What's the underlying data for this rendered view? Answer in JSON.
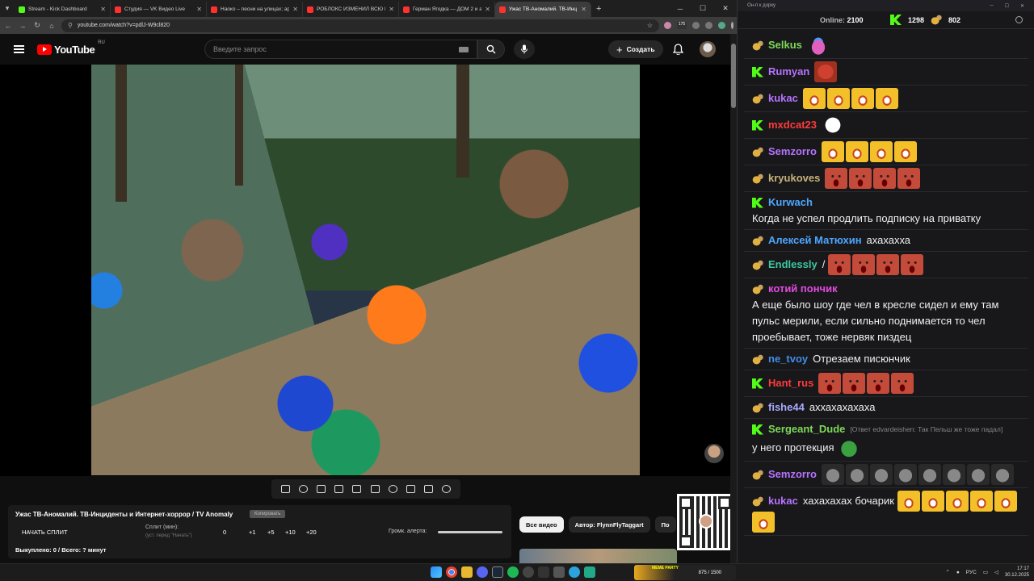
{
  "browser": {
    "tabs": [
      {
        "title": "Stream - Kick Dashboard",
        "color": "#53fc18"
      },
      {
        "title": "Студия — VK Видео Live",
        "color": "#ff3030"
      },
      {
        "title": "Наоко – песни на улицах; арс",
        "color": "#ff3030"
      },
      {
        "title": "РОБЛОКС ИЗМЕНИЛ ВСЮ МО",
        "color": "#ff3030"
      },
      {
        "title": "Герман Ягодка — ДОМ 2 и ав",
        "color": "#ff3030"
      },
      {
        "title": "Ужас ТВ-Аномалий. ТВ-Инц",
        "color": "#ff3030"
      }
    ],
    "url": "youtube.com/watch?v=pdlJ-W9cl820",
    "ext_badge": "175"
  },
  "youtube": {
    "logo": "YouTube",
    "region": "RU",
    "search_placeholder": "Введите запрос",
    "create_label": "Создать"
  },
  "panel": {
    "title": "Ужас ТВ-Аномалий. ТВ-Инциденты и Интернет-хоррор / TV Anomaly",
    "copy_label": "Копировать",
    "start_split": "НАЧАТЬ СПЛИТ",
    "split_label": "Сплит (мин):",
    "split_hint": "(уст. перед \"Начать\")",
    "split_value": "0",
    "plus": [
      "+1",
      "+5",
      "+10",
      "+20"
    ],
    "volume_label": "Громк. алерта:",
    "bought": "Выкуплено: 0 / Всего: ? минут"
  },
  "chips": [
    "Все видео",
    "Автор: FlynnFlyTaggart",
    "По"
  ],
  "chat": {
    "window_title": "Он-п к дорку",
    "online_label": "Online:",
    "online_value": "2100",
    "kick_count": "1298",
    "other_count": "802",
    "messages": [
      {
        "badge": "m",
        "name": "Selkus",
        "color": "#7ed957",
        "text": "",
        "emotes": [
          "pink"
        ]
      },
      {
        "badge": "k",
        "name": "Rumyan",
        "color": "#b673ff",
        "text": "",
        "emotes": [
          "red"
        ]
      },
      {
        "badge": "m",
        "name": "kukac",
        "color": "#b673ff",
        "text": "",
        "emotes": [
          "laugh",
          "laugh",
          "laugh",
          "laugh"
        ]
      },
      {
        "badge": "k",
        "name": "mxdcat23",
        "color": "#ff3b3b",
        "text": "",
        "emotes": [
          "smile"
        ]
      },
      {
        "badge": "m",
        "name": "Semzorro",
        "color": "#b673ff",
        "text": "",
        "emotes": [
          "laugh",
          "laugh",
          "laugh",
          "laugh"
        ]
      },
      {
        "badge": "m",
        "name": "kryukoves",
        "color": "#c8b27a",
        "text": "",
        "emotes": [
          "face",
          "face",
          "face",
          "face"
        ]
      },
      {
        "badge": "k",
        "name": "Kurwach",
        "color": "#4ea6ff",
        "text": "Когда не успел продлить подписку на приватку",
        "emotes": []
      },
      {
        "badge": "m",
        "name": "Алексей Матюхин",
        "color": "#4ea6ff",
        "text": "ахахахха",
        "emotes": []
      },
      {
        "badge": "m",
        "name": "Endlessly",
        "color": "#3cc7a0",
        "text": "/",
        "emotes": [
          "face",
          "face",
          "face",
          "face"
        ]
      },
      {
        "badge": "m",
        "name": "котий пончик",
        "color": "#e24be0",
        "text": "А еще было шоу где чел в кресле сидел и ему там пульс мерили, если сильно поднимается то чел проебывает, тоже нервяк пиздец",
        "emotes": []
      },
      {
        "badge": "m",
        "name": "ne_tvoy",
        "color": "#3f8ee8",
        "text": "Отрезаем писюнчик",
        "emotes": []
      },
      {
        "badge": "k",
        "name": "Hant_rus",
        "color": "#ff3b3b",
        "text": "",
        "emotes": [
          "face",
          "face",
          "face",
          "face"
        ]
      },
      {
        "badge": "m",
        "name": "fishe44",
        "color": "#a9a9ff",
        "text": "аххахахахаха",
        "emotes": []
      },
      {
        "badge": "k",
        "name": "Sergeant_Dude",
        "color": "#7ed957",
        "reply": "[Ответ edvardeishen: Так Пельш же тоже падал]",
        "text": "у него протекция",
        "emotes": [
          "pepe"
        ]
      },
      {
        "badge": "m",
        "name": "Semzorro",
        "color": "#b673ff",
        "text": "",
        "emotes": [
          "cat",
          "cat",
          "cat",
          "cat",
          "cat",
          "cat",
          "cat",
          "cat"
        ]
      },
      {
        "badge": "m",
        "name": "kukac",
        "color": "#b673ff",
        "text": "хахахахах бочарик",
        "emotes": [
          "laugh",
          "laugh",
          "laugh",
          "laugh",
          "laugh",
          "laugh"
        ]
      }
    ]
  },
  "taskbar": {
    "meme_label": "MEME PARTY",
    "meme_count": "875 / 1500",
    "lang": "РУС",
    "time": "17:17",
    "date": "30.12.2025"
  }
}
